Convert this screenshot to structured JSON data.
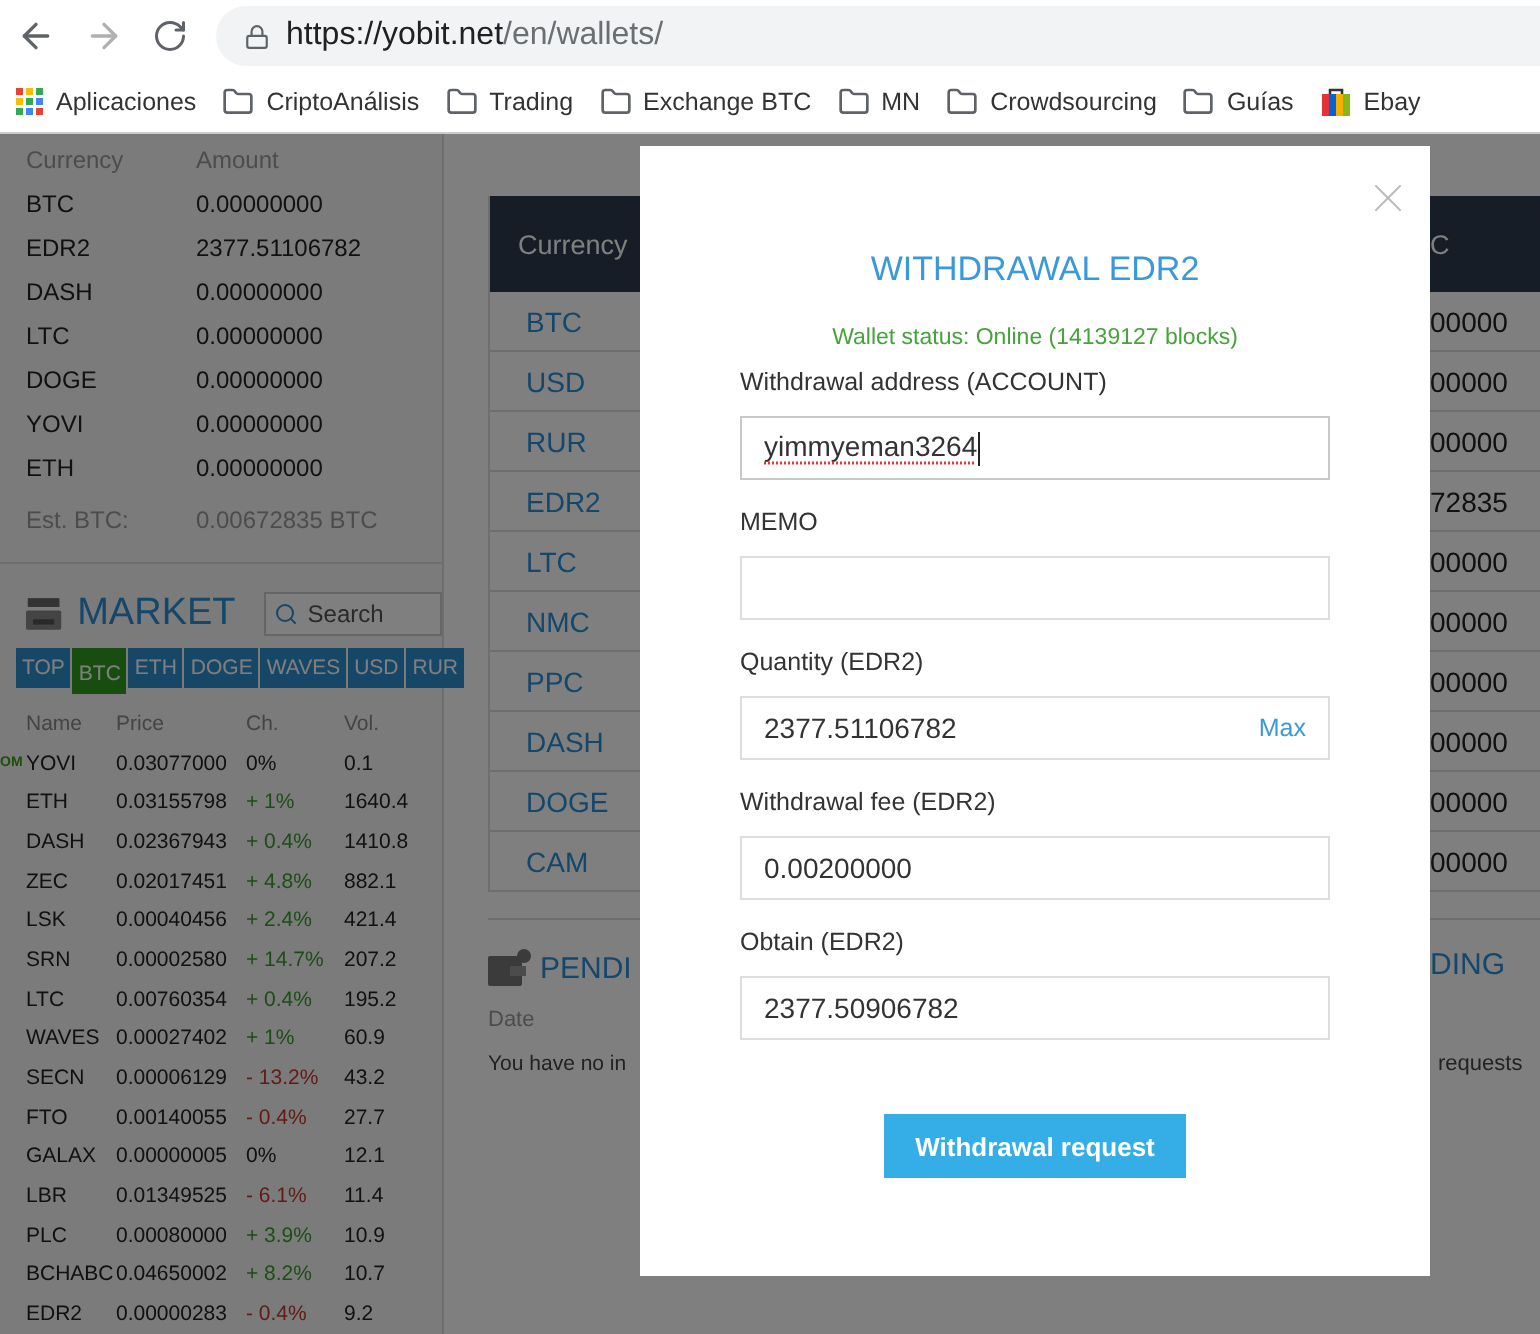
{
  "browser": {
    "back": {
      "disabled": false
    },
    "forward": {
      "disabled": true
    },
    "url_host": "https://yobit.net",
    "url_path": "/en/wallets/"
  },
  "bookmarks": [
    {
      "label": "Aplicaciones",
      "kind": "apps"
    },
    {
      "label": "CriptoAnálisis",
      "kind": "folder"
    },
    {
      "label": "Trading",
      "kind": "folder"
    },
    {
      "label": "Exchange BTC",
      "kind": "folder"
    },
    {
      "label": "MN",
      "kind": "folder"
    },
    {
      "label": "Crowdsourcing",
      "kind": "folder"
    },
    {
      "label": "Guías",
      "kind": "folder"
    },
    {
      "label": "Ebay",
      "kind": "shop"
    }
  ],
  "wallet": {
    "columns": [
      "Currency",
      "Amount"
    ],
    "rows": [
      {
        "currency": "BTC",
        "amount": "0.00000000"
      },
      {
        "currency": "EDR2",
        "amount": "2377.51106782"
      },
      {
        "currency": "DASH",
        "amount": "0.00000000"
      },
      {
        "currency": "LTC",
        "amount": "0.00000000"
      },
      {
        "currency": "DOGE",
        "amount": "0.00000000"
      },
      {
        "currency": "YOVI",
        "amount": "0.00000000"
      },
      {
        "currency": "ETH",
        "amount": "0.00000000"
      }
    ],
    "estimate": {
      "label": "Est. BTC:",
      "value": "0.00672835 BTC"
    }
  },
  "market": {
    "title": "MARKET",
    "search": {
      "placeholder": "Search"
    },
    "tabs": [
      {
        "label": "TOP",
        "selected": false
      },
      {
        "label": "BTC",
        "selected": true
      },
      {
        "label": "ETH",
        "selected": false
      },
      {
        "label": "DOGE",
        "selected": false
      },
      {
        "label": "WAVES",
        "selected": false
      },
      {
        "label": "USD",
        "selected": false
      },
      {
        "label": "RUR",
        "selected": false
      }
    ],
    "columns": [
      "Name",
      "Price",
      "Ch.",
      "Vol."
    ],
    "rows": [
      {
        "badge": "OM",
        "name": "YOVI",
        "price": "0.03077000",
        "change": "0%",
        "kind": "flat",
        "volume": "0.1"
      },
      {
        "name": "ETH",
        "price": "0.03155798",
        "change": "+ 1%",
        "kind": "up",
        "volume": "1640.4"
      },
      {
        "name": "DASH",
        "price": "0.02367943",
        "change": "+ 0.4%",
        "kind": "up",
        "volume": "1410.8"
      },
      {
        "name": "ZEC",
        "price": "0.02017451",
        "change": "+ 4.8%",
        "kind": "up",
        "volume": "882.1"
      },
      {
        "name": "LSK",
        "price": "0.00040456",
        "change": "+ 2.4%",
        "kind": "up",
        "volume": "421.4"
      },
      {
        "name": "SRN",
        "price": "0.00002580",
        "change": "+ 14.7%",
        "kind": "up",
        "volume": "207.2"
      },
      {
        "name": "LTC",
        "price": "0.00760354",
        "change": "+ 0.4%",
        "kind": "up",
        "volume": "195.2"
      },
      {
        "name": "WAVES",
        "price": "0.00027402",
        "change": "+ 1%",
        "kind": "up",
        "volume": "60.9"
      },
      {
        "name": "SECN",
        "price": "0.00006129",
        "change": "- 13.2%",
        "kind": "down",
        "volume": "43.2"
      },
      {
        "name": "FTO",
        "price": "0.00140055",
        "change": "- 0.4%",
        "kind": "down",
        "volume": "27.7"
      },
      {
        "name": "GALAX",
        "price": "0.00000005",
        "change": "0%",
        "kind": "flat",
        "volume": "12.1"
      },
      {
        "name": "LBR",
        "price": "0.01349525",
        "change": "- 6.1%",
        "kind": "down",
        "volume": "11.4"
      },
      {
        "name": "PLC",
        "price": "0.00080000",
        "change": "+ 3.9%",
        "kind": "up",
        "volume": "10.9"
      },
      {
        "name": "BCHABC",
        "price": "0.04650002",
        "change": "+ 8.2%",
        "kind": "up",
        "volume": "10.7"
      },
      {
        "name": "EDR2",
        "price": "0.00000283",
        "change": "- 0.4%",
        "kind": "down",
        "volume": "9.2"
      }
    ]
  },
  "balances": {
    "currency_header": "Currency",
    "column_2_header": "C",
    "rows": [
      {
        "currency": "BTC",
        "column_2": "00000"
      },
      {
        "currency": "USD",
        "column_2": "00000"
      },
      {
        "currency": "RUR",
        "column_2": "00000"
      },
      {
        "currency": "EDR2",
        "column_2": "72835"
      },
      {
        "currency": "LTC",
        "column_2": "00000"
      },
      {
        "currency": "NMC",
        "column_2": "00000"
      },
      {
        "currency": "PPC",
        "column_2": "00000"
      },
      {
        "currency": "DASH",
        "column_2": "00000"
      },
      {
        "currency": "DOGE",
        "column_2": "00000"
      },
      {
        "currency": "CAM",
        "column_2": "00000"
      }
    ]
  },
  "pending": {
    "title_left": "PENDI",
    "title_right": "DING",
    "date_header": "Date",
    "message_left": "You have no in",
    "message_right": "requests"
  },
  "modal": {
    "title": "WITHDRAWAL EDR2",
    "status": "Wallet status: Online (14139127 blocks)",
    "fields": [
      {
        "label": "Withdrawal address (ACCOUNT)",
        "value": "yimmyeman3264",
        "misspelled": true,
        "focused": true
      },
      {
        "label": "MEMO"
      },
      {
        "label": "Quantity (EDR2)",
        "value": "2377.51106782",
        "action": "Max"
      },
      {
        "label": "Withdrawal fee (EDR2)",
        "value": "0.00200000"
      },
      {
        "label": "Obtain (EDR2)",
        "value": "2377.50906782"
      }
    ],
    "button": "Withdrawal request"
  }
}
